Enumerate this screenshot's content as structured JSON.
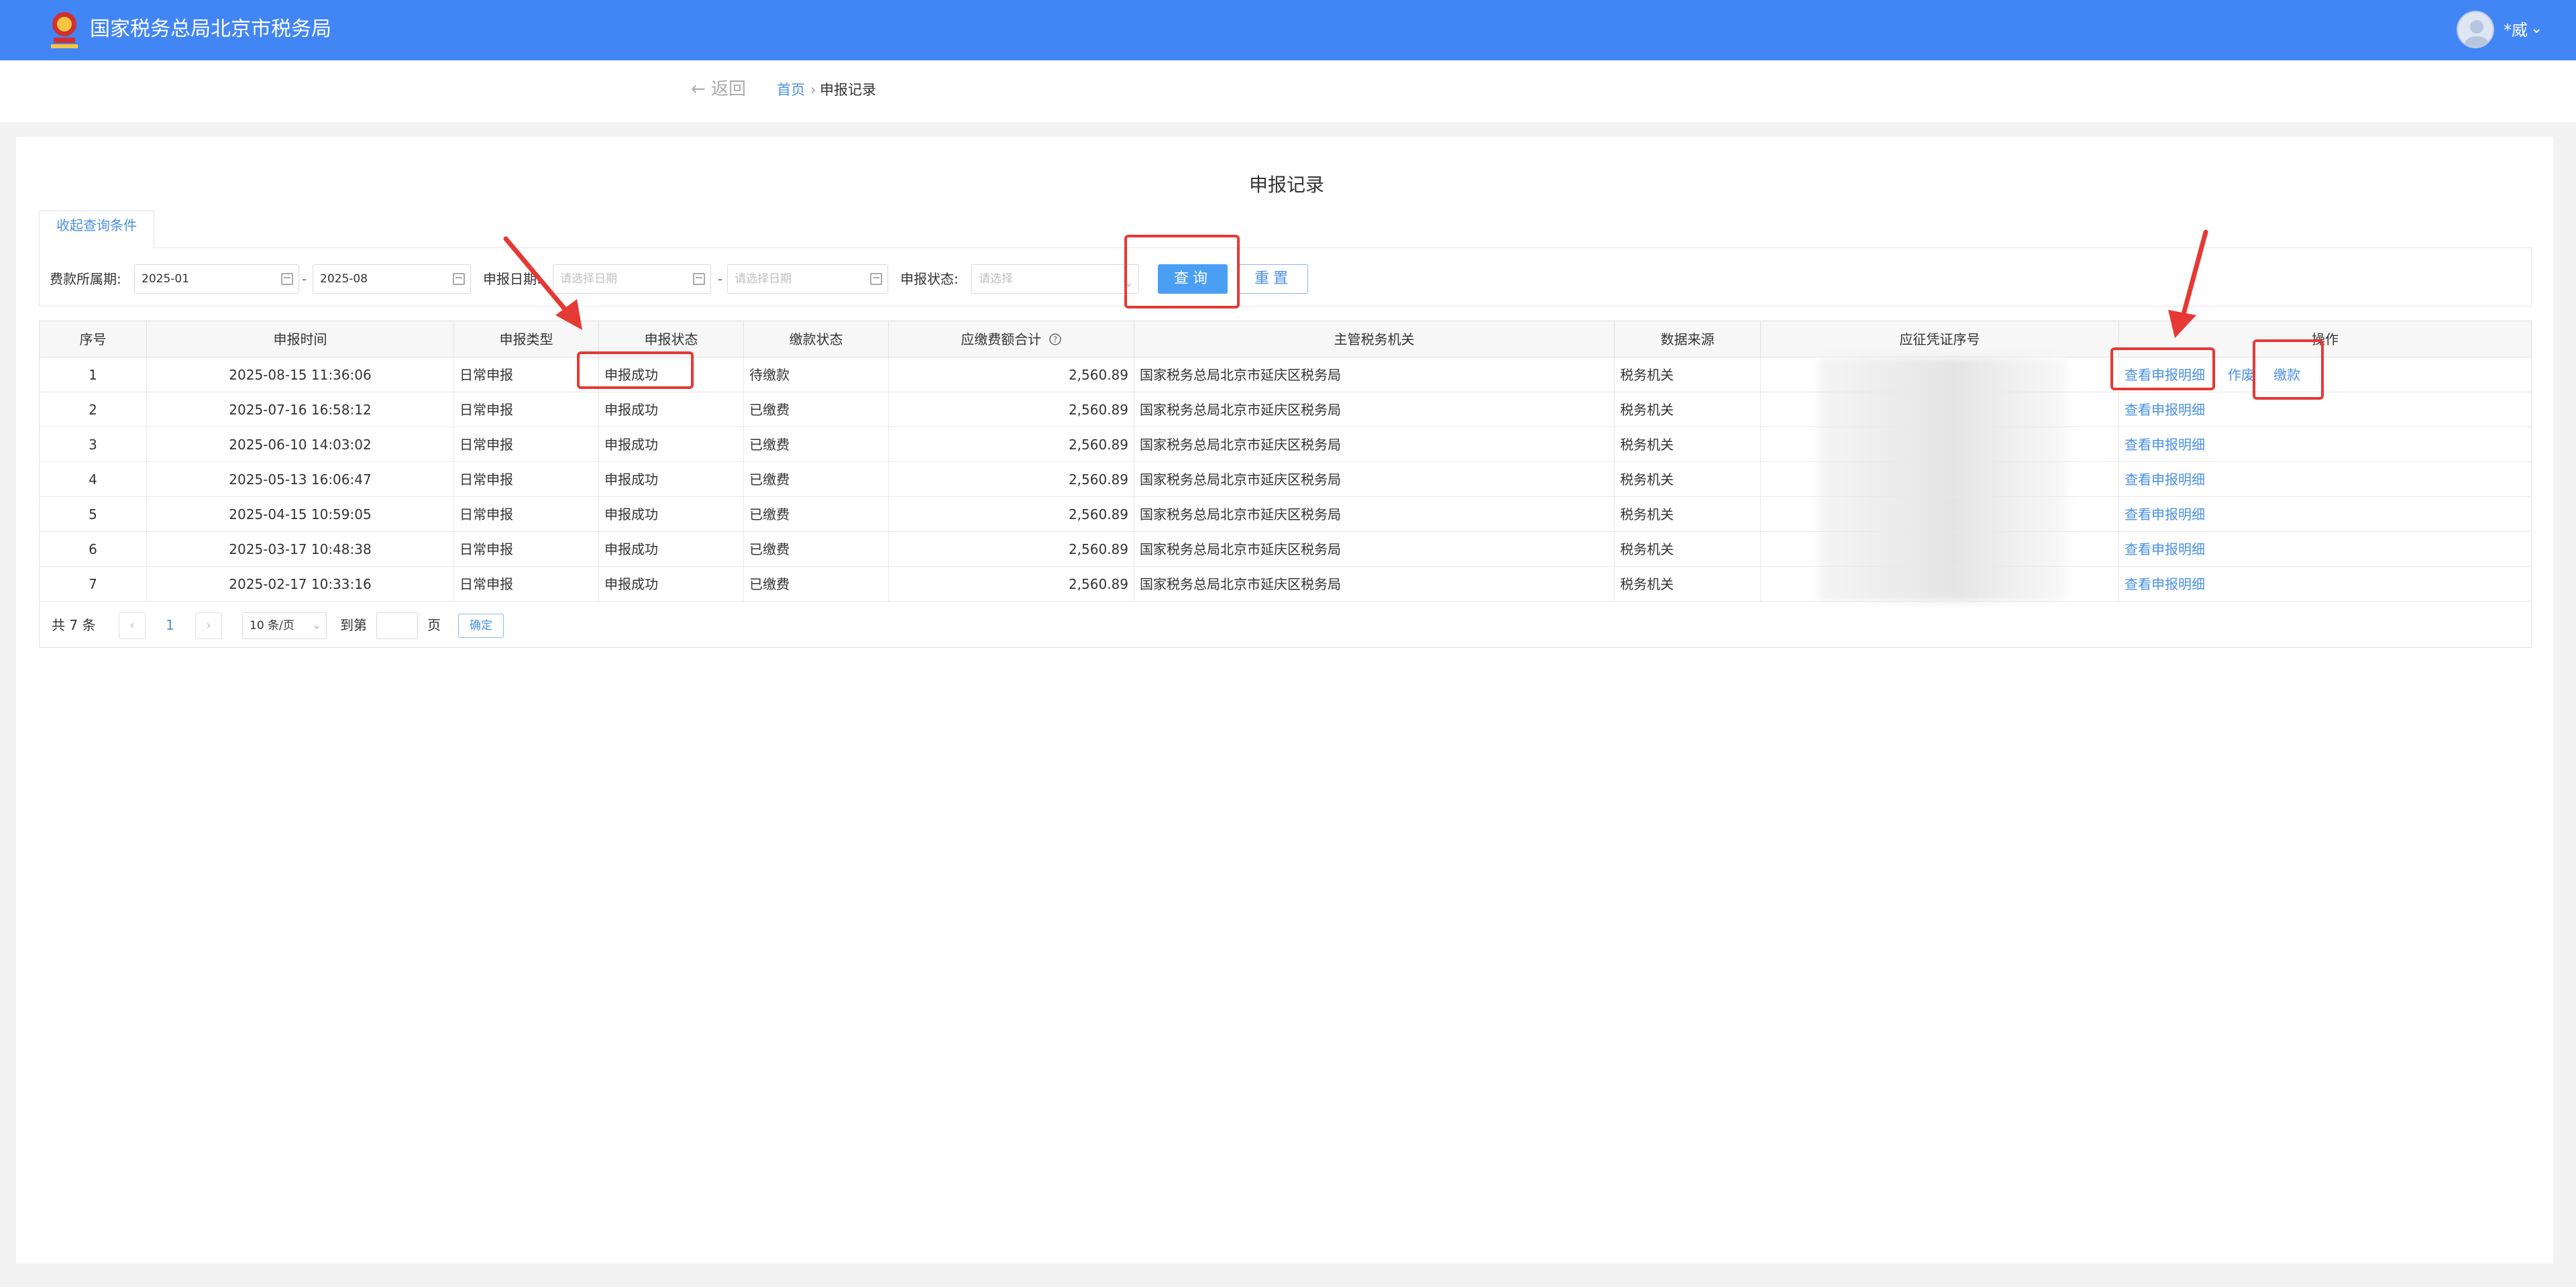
{
  "header": {
    "site_title": "国家税务总局北京市税务局",
    "user_name": "*威",
    "user_caret": "⌄"
  },
  "breadcrumb": {
    "back": "← 返回",
    "home": "首页",
    "separator": "›",
    "current": "申报记录"
  },
  "page_title": "申报记录",
  "filters": {
    "collapse_label": "收起查询条件",
    "period_label": "费款所属期:",
    "period_start": "2025-01",
    "period_end": "2025-08",
    "range_dash": "-",
    "declare_date_label": "申报日期:",
    "declare_date_start_placeholder": "请选择日期",
    "declare_date_end_placeholder": "请选择日期",
    "status_label": "申报状态:",
    "status_placeholder": "请选择",
    "query_button": "查询",
    "reset_button": "重置"
  },
  "table": {
    "columns": [
      "序号",
      "申报时间",
      "申报类型",
      "申报状态",
      "缴款状态",
      "应缴费额合计",
      "主管税务机关",
      "数据来源",
      "应征凭证序号",
      "操作"
    ],
    "rows": [
      {
        "no": "1",
        "time": "2025-08-15 11:36:06",
        "type": "日常申报",
        "status": "申报成功",
        "pay_status": "待缴款",
        "amount": "2,560.89",
        "authority": "国家税务总局北京市延庆区税务局",
        "source": "税务机关",
        "actions": [
          "查看申报明细",
          "作废",
          "缴款"
        ]
      },
      {
        "no": "2",
        "time": "2025-07-16 16:58:12",
        "type": "日常申报",
        "status": "申报成功",
        "pay_status": "已缴费",
        "amount": "2,560.89",
        "authority": "国家税务总局北京市延庆区税务局",
        "source": "税务机关",
        "actions": [
          "查看申报明细"
        ]
      },
      {
        "no": "3",
        "time": "2025-06-10 14:03:02",
        "type": "日常申报",
        "status": "申报成功",
        "pay_status": "已缴费",
        "amount": "2,560.89",
        "authority": "国家税务总局北京市延庆区税务局",
        "source": "税务机关",
        "actions": [
          "查看申报明细"
        ]
      },
      {
        "no": "4",
        "time": "2025-05-13 16:06:47",
        "type": "日常申报",
        "status": "申报成功",
        "pay_status": "已缴费",
        "amount": "2,560.89",
        "authority": "国家税务总局北京市延庆区税务局",
        "source": "税务机关",
        "actions": [
          "查看申报明细"
        ]
      },
      {
        "no": "5",
        "time": "2025-04-15 10:59:05",
        "type": "日常申报",
        "status": "申报成功",
        "pay_status": "已缴费",
        "amount": "2,560.89",
        "authority": "国家税务总局北京市延庆区税务局",
        "source": "税务机关",
        "actions": [
          "查看申报明细"
        ]
      },
      {
        "no": "6",
        "time": "2025-03-17 10:48:38",
        "type": "日常申报",
        "status": "申报成功",
        "pay_status": "已缴费",
        "amount": "2,560.89",
        "authority": "国家税务总局北京市延庆区税务局",
        "source": "税务机关",
        "actions": [
          "查看申报明细"
        ]
      },
      {
        "no": "7",
        "time": "2025-02-17 10:33:16",
        "type": "日常申报",
        "status": "申报成功",
        "pay_status": "已缴费",
        "amount": "2,560.89",
        "authority": "国家税务总局北京市延庆区税务局",
        "source": "税务机关",
        "actions": [
          "查看申报明细"
        ]
      }
    ]
  },
  "pagination": {
    "total": "共 7 条",
    "prev": "‹",
    "next": "›",
    "current_page": "1",
    "page_size": "10 条/页",
    "goto_label": "到第",
    "page_suffix": "页",
    "confirm": "确定"
  },
  "colors": {
    "header_blue": "#4285f4",
    "link_blue": "#4a90e2",
    "annotation_red": "#e53935"
  },
  "icons": [
    "emblem-icon",
    "user-avatar-icon",
    "calendar-icon",
    "chevron-down-icon",
    "question-circle-icon"
  ]
}
